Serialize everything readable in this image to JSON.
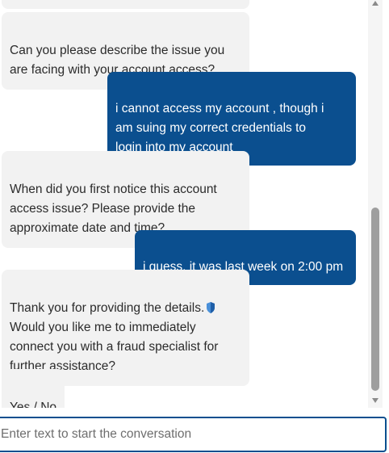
{
  "chat": {
    "messages": [
      {
        "sender": "bot",
        "text": "Can you please describe the issue you\nare facing with your account access?"
      },
      {
        "sender": "user",
        "text": "i cannot access my account , though i\nam suing my correct credentials to\nlogin into my account"
      },
      {
        "sender": "bot",
        "text": "When did you first notice this account\naccess issue? Please provide the\napproximate date and time?"
      },
      {
        "sender": "user",
        "text": "i guess, it was last week on 2:00 pm"
      },
      {
        "sender": "bot",
        "text_part1": "Thank you for providing the details.",
        "text_part2": "Would you like me to immediately\nconnect you with a fraud specialist for\nfurther assistance?",
        "icon": "shield-icon"
      },
      {
        "sender": "bot",
        "text": "Yes / No"
      }
    ]
  },
  "input": {
    "placeholder": "Enter text to start the conversation",
    "value": ""
  },
  "colors": {
    "user_bubble": "#0b4f8f",
    "bot_bubble": "#f2f2f2",
    "input_border": "#0b4f8f"
  }
}
